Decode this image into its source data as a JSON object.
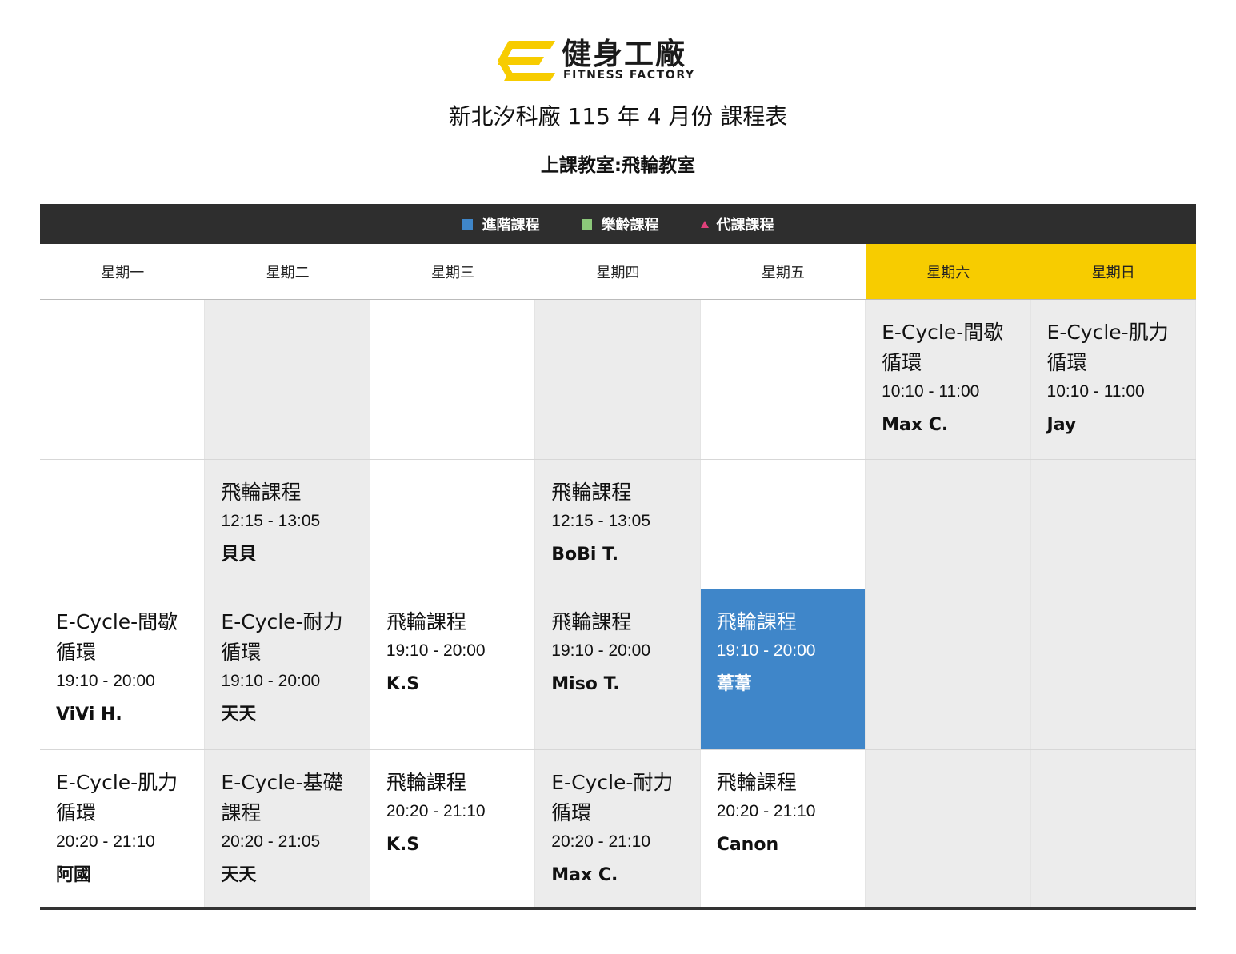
{
  "logo": {
    "name_cn": "健身工廠",
    "name_en": "FITNESS FACTORY",
    "brand_color": "#f7cc00"
  },
  "title": "新北汐科廠 115 年 4 月份 課程表",
  "subtitle": "上課教室:飛輪教室",
  "legend": [
    {
      "label": "進階課程",
      "color": "#3f86c9",
      "shape": "square"
    },
    {
      "label": "樂齡課程",
      "color": "#8cc87a",
      "shape": "square"
    },
    {
      "label": "代課課程",
      "color": "#e0407a",
      "shape": "triangle"
    }
  ],
  "days": [
    "星期一",
    "星期二",
    "星期三",
    "星期四",
    "星期五",
    "星期六",
    "星期日"
  ],
  "rows": [
    [
      null,
      null,
      null,
      null,
      null,
      {
        "name": "E-Cycle-間歇循環",
        "time": "10:10 - 11:00",
        "coach": "Max C."
      },
      {
        "name": "E-Cycle-肌力循環",
        "time": "10:10 - 11:00",
        "coach": "Jay"
      }
    ],
    [
      null,
      {
        "name": "飛輪課程",
        "time": "12:15 - 13:05",
        "coach": "貝貝"
      },
      null,
      {
        "name": "飛輪課程",
        "time": "12:15 - 13:05",
        "coach": "BoBi T."
      },
      null,
      null,
      null
    ],
    [
      {
        "name": "E-Cycle-間歇循環",
        "time": "19:10 - 20:00",
        "coach": "ViVi H."
      },
      {
        "name": "E-Cycle-耐力循環",
        "time": "19:10 - 20:00",
        "coach": "天天"
      },
      {
        "name": "飛輪課程",
        "time": "19:10 - 20:00",
        "coach": "K.S"
      },
      {
        "name": "飛輪課程",
        "time": "19:10 - 20:00",
        "coach": "Miso T."
      },
      {
        "name": "飛輪課程",
        "time": "19:10 - 20:00",
        "coach": "葦葦",
        "type": "advanced"
      },
      null,
      null
    ],
    [
      {
        "name": "E-Cycle-肌力循環",
        "time": "20:20 - 21:10",
        "coach": "阿國"
      },
      {
        "name": "E-Cycle-基礎課程",
        "time": "20:20 - 21:05",
        "coach": "天天"
      },
      {
        "name": "飛輪課程",
        "time": "20:20 - 21:10",
        "coach": "K.S"
      },
      {
        "name": "E-Cycle-耐力循環",
        "time": "20:20 - 21:10",
        "coach": "Max C."
      },
      {
        "name": "飛輪課程",
        "time": "20:20 - 21:10",
        "coach": "Canon"
      },
      null,
      null
    ]
  ]
}
